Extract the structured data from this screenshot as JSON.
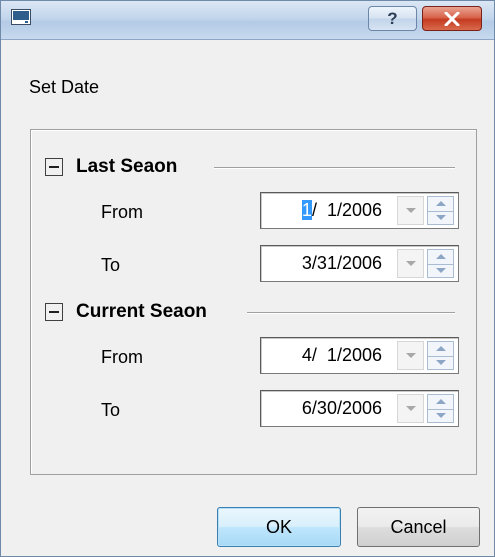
{
  "window": {
    "title": "",
    "help_glyph": "?",
    "colors": {
      "titlebar": "#c3d6ec",
      "close_button": "#c53b21",
      "selection": "#3399ff"
    }
  },
  "dialog": {
    "label": "Set Date"
  },
  "sections": [
    {
      "title": "Last Seaon",
      "toggle_glyph": "minus-box-icon",
      "rows": [
        {
          "label": "From",
          "date_parts": {
            "selected": "1",
            "rest": "/  1/2006"
          }
        },
        {
          "label": "To",
          "date_parts": {
            "selected": "",
            "rest": "3/31/2006"
          }
        }
      ]
    },
    {
      "title": "Current Seaon",
      "toggle_glyph": "minus-box-icon",
      "rows": [
        {
          "label": "From",
          "date_parts": {
            "selected": "",
            "rest": "4/  1/2006"
          }
        },
        {
          "label": "To",
          "date_parts": {
            "selected": "",
            "rest": "6/30/2006"
          }
        }
      ]
    }
  ],
  "buttons": {
    "ok": "OK",
    "cancel": "Cancel"
  }
}
